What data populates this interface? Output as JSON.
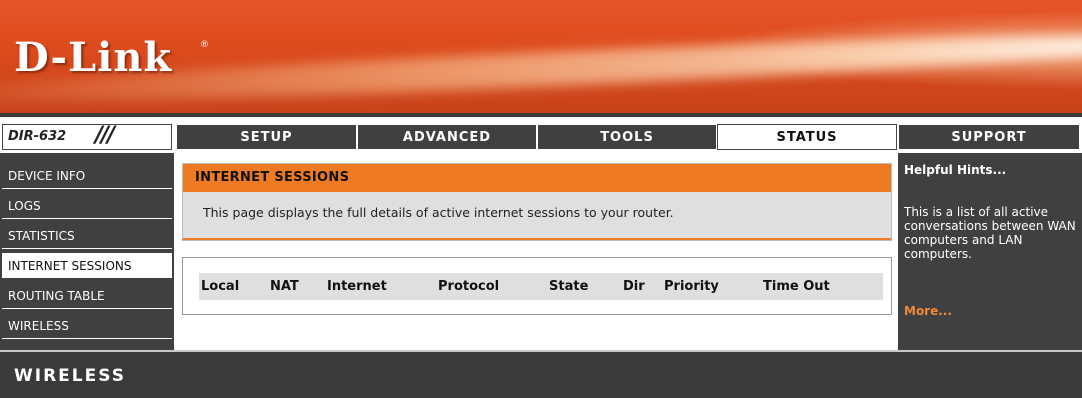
{
  "brand": {
    "logo": "D-Link",
    "reg_mark": "®",
    "model": "DIR-632",
    "model_slashes": "///"
  },
  "nav_tabs": [
    {
      "label": "SETUP",
      "active": false
    },
    {
      "label": "ADVANCED",
      "active": false
    },
    {
      "label": "TOOLS",
      "active": false
    },
    {
      "label": "STATUS",
      "active": true
    },
    {
      "label": "SUPPORT",
      "active": false
    }
  ],
  "sidebar": {
    "items": [
      {
        "label": "DEVICE INFO",
        "active": false
      },
      {
        "label": "LOGS",
        "active": false
      },
      {
        "label": "STATISTICS",
        "active": false
      },
      {
        "label": "INTERNET SESSIONS",
        "active": true
      },
      {
        "label": "ROUTING TABLE",
        "active": false
      },
      {
        "label": "WIRELESS",
        "active": false
      }
    ]
  },
  "main": {
    "section_title": "INTERNET SESSIONS",
    "description": "This page displays the full details of active internet sessions to your router.",
    "table": {
      "columns": [
        "Local",
        "NAT",
        "Internet",
        "Protocol",
        "State",
        "Dir",
        "Priority",
        "Time Out"
      ]
    }
  },
  "hints": {
    "title": "Helpful Hints...",
    "text": "This is a list of all active conversations between WAN computers and LAN computers.",
    "more": "More..."
  },
  "footer": {
    "label": "WIRELESS"
  },
  "colors": {
    "brand_orange": "#dd4b1d",
    "accent_orange": "#ef7a24",
    "dark_gray": "#404040",
    "link_orange": "#f08a3a"
  }
}
